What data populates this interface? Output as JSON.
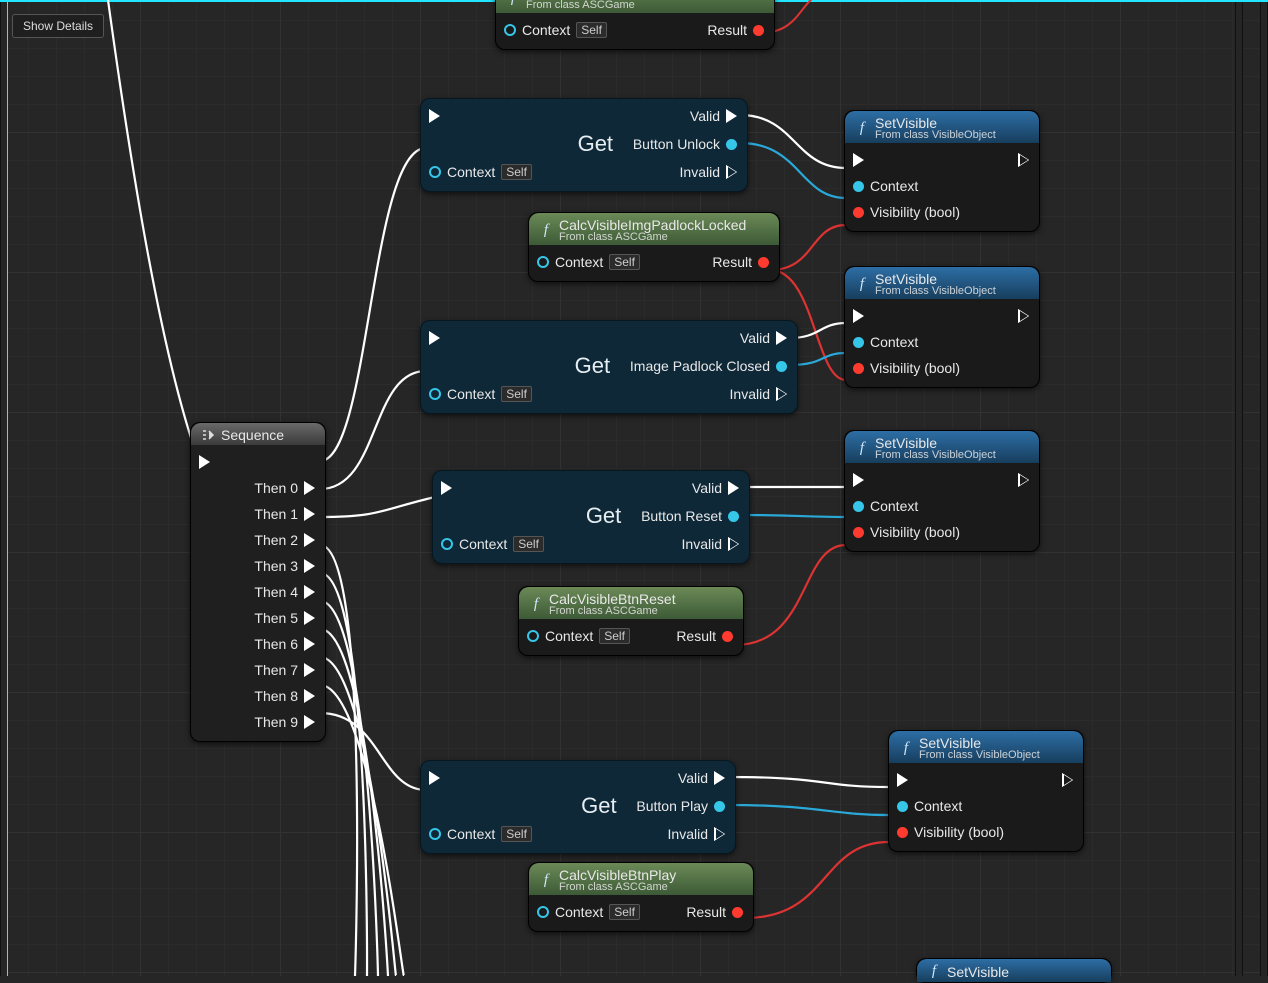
{
  "btn_showdetails": "Show Details",
  "sequence": {
    "title": "Sequence",
    "items": [
      "Then 0",
      "Then 1",
      "Then 2",
      "Then 3",
      "Then 4",
      "Then 5",
      "Then 6",
      "Then 7",
      "Then 8",
      "Then 9"
    ]
  },
  "labels": {
    "context": "Context",
    "self": "Self",
    "result": "Result",
    "valid": "Valid",
    "invalid": "Invalid",
    "visibility": "Visibility (bool)",
    "get": "Get"
  },
  "calc_top": {
    "sub": "From class ASCGame"
  },
  "calc1": {
    "title": "CalcVisibleImgPadlockLocked",
    "sub": "From class ASCGame"
  },
  "calc2": {
    "title": "CalcVisibleBtnReset",
    "sub": "From class ASCGame"
  },
  "calc3": {
    "title": "CalcVisibleBtnPlay",
    "sub": "From class ASCGame"
  },
  "get1": {
    "out": "Button Unlock"
  },
  "get2": {
    "out": "Image Padlock Closed"
  },
  "get3": {
    "out": "Button Reset"
  },
  "get4": {
    "out": "Button Play"
  },
  "sv": {
    "title": "SetVisible",
    "sub": "From class VisibleObject"
  }
}
